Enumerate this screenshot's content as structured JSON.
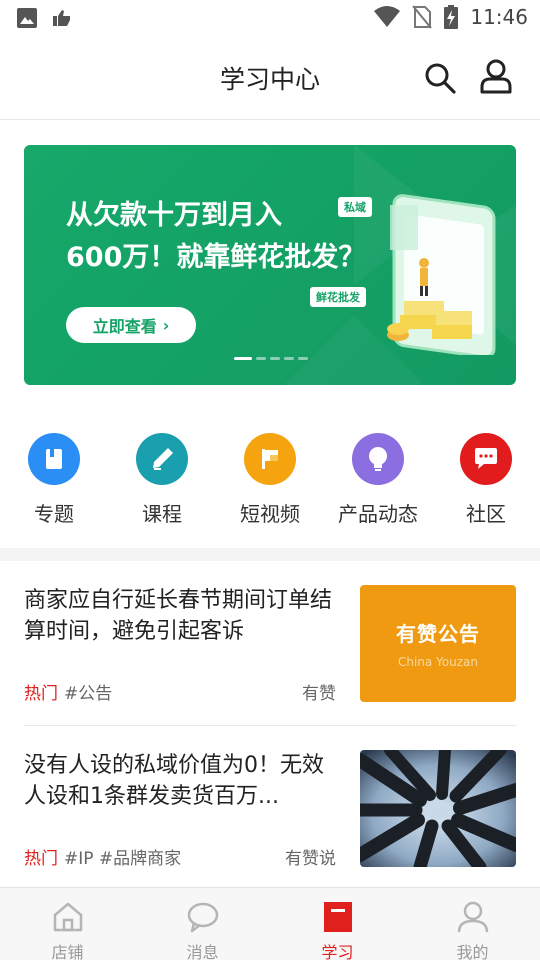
{
  "status_bar": {
    "time": "11:46",
    "icons": [
      "image-icon",
      "thumbs-up-icon",
      "wifi-icon",
      "no-sim-icon",
      "battery-charging-icon"
    ]
  },
  "header": {
    "title": "学习中心",
    "icons": [
      "search-icon",
      "user-icon"
    ]
  },
  "banner": {
    "title_line1": "从欠款十万到月入",
    "title_line2": "600万！就靠鲜花批发？",
    "button_label": "立即查看",
    "tag_private": "私域",
    "tag_wholesale": "鲜花批发",
    "slides_total": 5,
    "active_slide": 1,
    "color": "#15a266"
  },
  "categories": [
    {
      "label": "专题",
      "icon": "book-icon",
      "color": "#2b8ef5"
    },
    {
      "label": "课程",
      "icon": "pen-icon",
      "color": "#1a9fae"
    },
    {
      "label": "短视频",
      "icon": "flag-icon",
      "color": "#f5a40f"
    },
    {
      "label": "产品动态",
      "icon": "lightbulb-icon",
      "color": "#8b6ee0"
    },
    {
      "label": "社区",
      "icon": "chat-icon",
      "color": "#e21c1c"
    }
  ],
  "articles": [
    {
      "title": "商家应自行延长春节期间订单结算时间，避免引起客诉",
      "hot": "热门",
      "tags": "#公告",
      "source": "有赞",
      "thumb_title": "有赞公告",
      "thumb_subtitle": "China Youzan"
    },
    {
      "title": "没有人设的私域价值为0！无效人设和1条群发卖货百万...",
      "hot": "热门",
      "tags": "#IP #品牌商家",
      "source": "有赞说"
    }
  ],
  "tabbar": {
    "items": [
      {
        "label": "店铺",
        "icon": "store-icon"
      },
      {
        "label": "消息",
        "icon": "message-icon"
      },
      {
        "label": "学习",
        "icon": "study-icon"
      },
      {
        "label": "我的",
        "icon": "profile-icon"
      }
    ],
    "active": "学习",
    "active_color": "#e0201d"
  }
}
